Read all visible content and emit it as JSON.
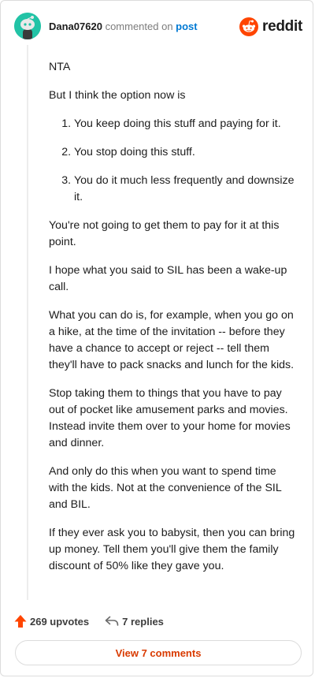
{
  "comment": {
    "username": "Dana07620",
    "action_text": " commented on ",
    "post_link": "post"
  },
  "brand": {
    "name": "reddit",
    "color": "#ff4500"
  },
  "body": {
    "p1": "NTA",
    "p2": "But I think the option now is",
    "list": [
      "You keep doing this stuff and paying for it.",
      "You stop doing this stuff.",
      "You do it much less frequently and downsize it."
    ],
    "p3": "You're not going to get them to pay for it at this point.",
    "p4": "I hope what you said to SIL has been a wake-up call.",
    "p5": "What you can do is, for example, when you go on a hike, at the time of the invitation -- before they have a chance to accept or reject -- tell them they'll have to pack snacks and lunch for the kids.",
    "p6": "Stop taking them to things that you have to pay out of pocket like amusement parks and movies. Instead invite them over to your home for movies and dinner.",
    "p7": "And only do this when you want to spend time with the kids. Not at the convenience of the SIL and BIL.",
    "p8": "If they ever ask you to babysit, then you can bring up money. Tell them you'll give them the family discount of 50% like they gave you."
  },
  "footer": {
    "upvotes": "269 upvotes",
    "replies": "7 replies",
    "view_comments": "View 7 comments"
  },
  "colors": {
    "upvote": "#ff4500",
    "avatar": "#22c3a6",
    "link": "#0079d3",
    "view_button_text": "#d93a00"
  }
}
